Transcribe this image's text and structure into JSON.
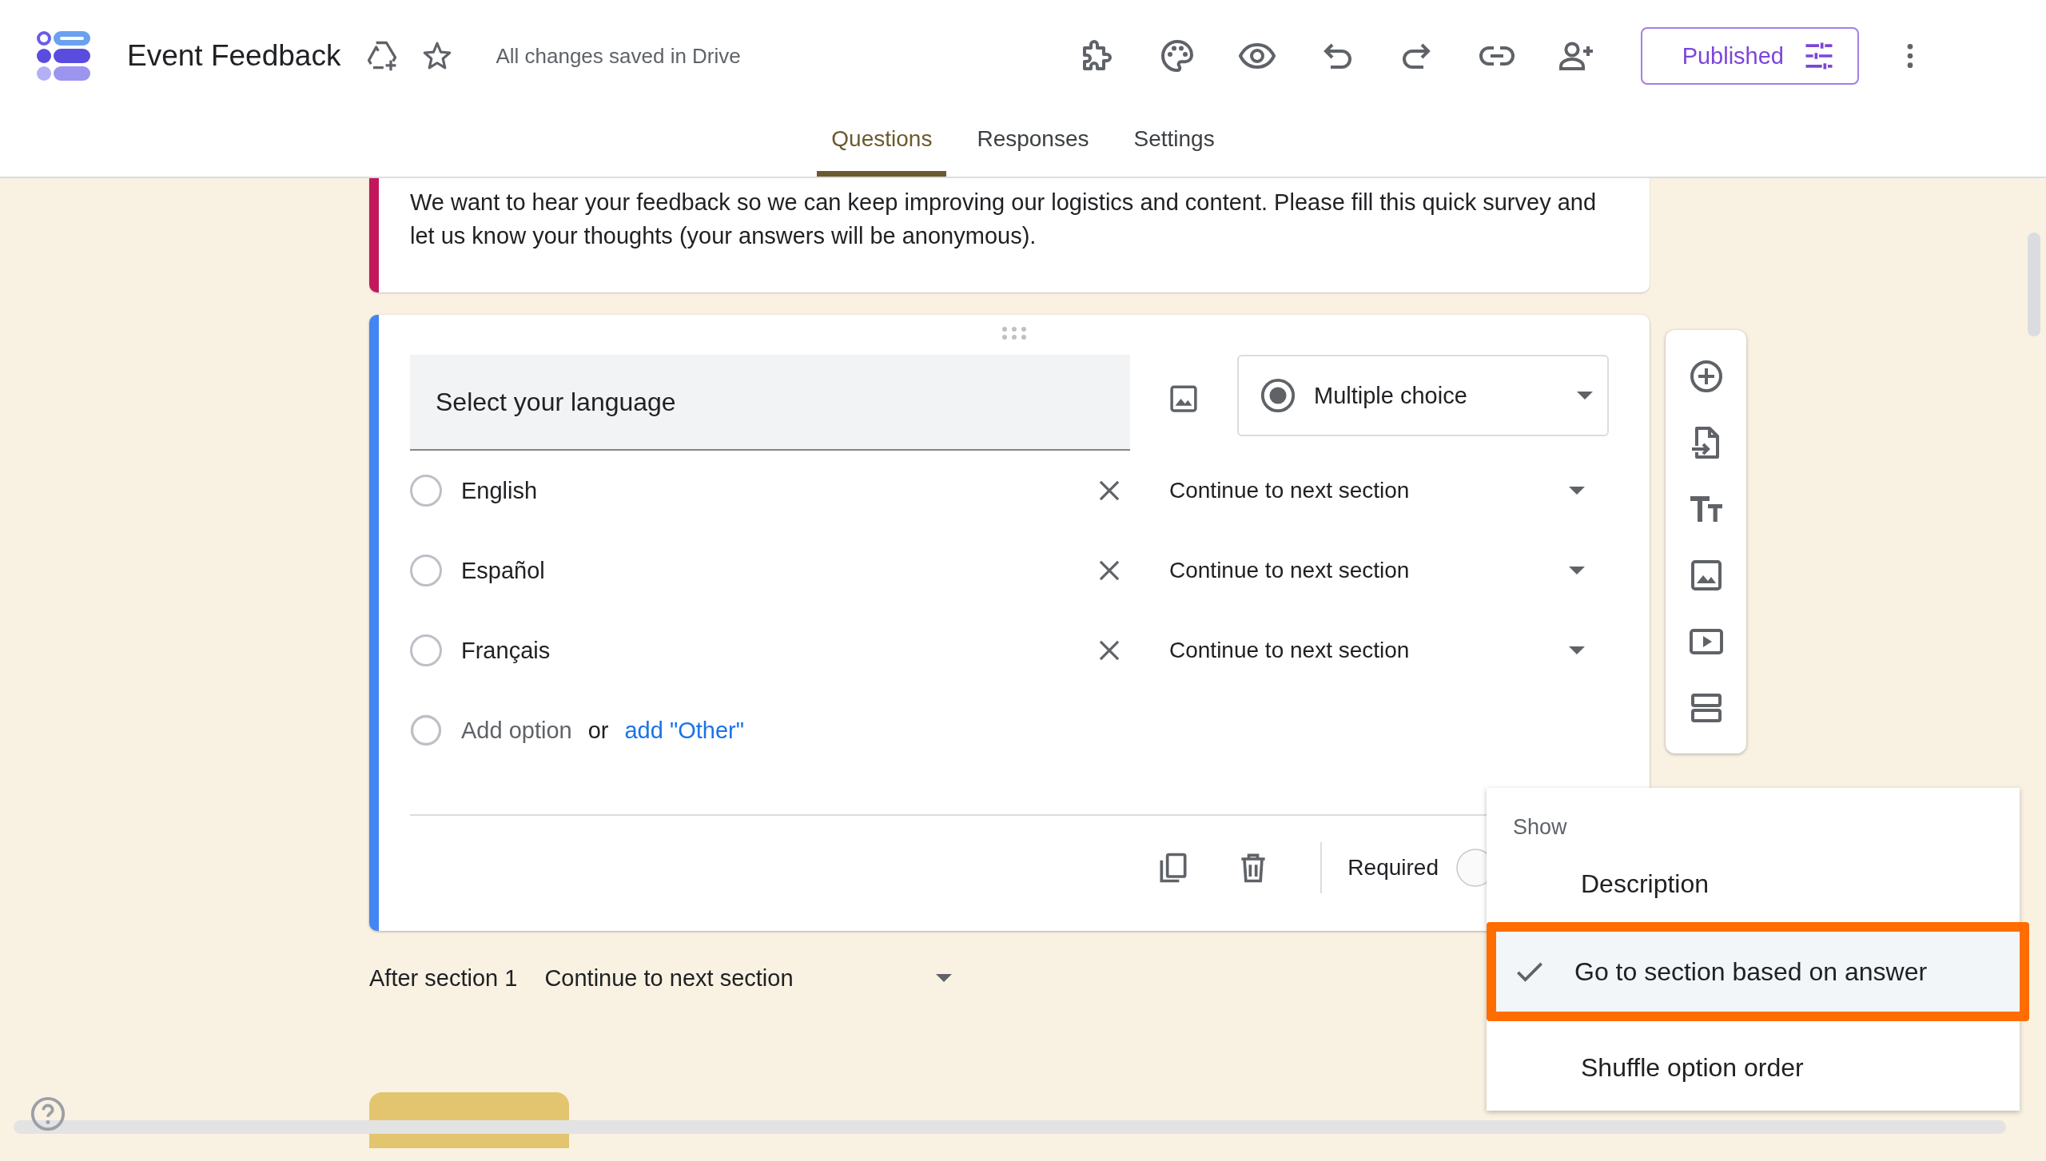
{
  "app": {
    "title": "Event Feedback",
    "save_status": "All changes saved in Drive",
    "publish_button": "Published"
  },
  "tabs": [
    {
      "label": "Questions",
      "selected": true
    },
    {
      "label": "Responses",
      "selected": false
    },
    {
      "label": "Settings",
      "selected": false
    }
  ],
  "description": "We want to hear your feedback so we can keep improving our logistics and content. Please fill this quick survey and let us know your thoughts (your answers will be anonymous).",
  "question": {
    "title": "Select your language",
    "type": "Multiple choice",
    "options": [
      {
        "label": "English",
        "selected": false,
        "go_to": "Continue to next section"
      },
      {
        "label": "Español",
        "selected": false,
        "go_to": "Continue to next section"
      },
      {
        "label": "Français",
        "selected": false,
        "go_to": "Continue to next section"
      }
    ],
    "add_option": "Add option",
    "or": "or",
    "add_other": "add \"Other\"",
    "required_label": "Required",
    "required": false
  },
  "after_section": {
    "label": "After section 1",
    "value": "Continue to next section"
  },
  "menu": {
    "heading": "Show",
    "items": [
      {
        "label": "Description",
        "checked": false,
        "highlighted": false
      },
      {
        "label": "Go to section based on answer",
        "checked": true,
        "highlighted": true
      },
      {
        "label": "Shuffle option order",
        "checked": false,
        "highlighted": false
      }
    ]
  }
}
